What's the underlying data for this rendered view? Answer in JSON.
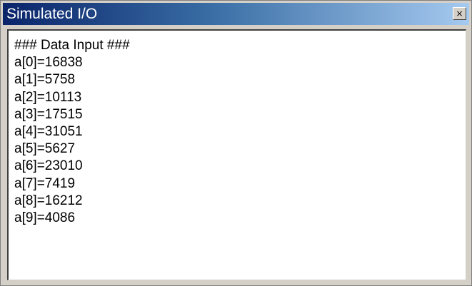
{
  "window": {
    "title": "Simulated I/O",
    "close_glyph": "×",
    "close_icon": "close-icon"
  },
  "output": {
    "lines": [
      "### Data Input ###",
      "a[0]=16838",
      "a[1]=5758",
      "a[2]=10113",
      "a[3]=17515",
      "a[4]=31051",
      "a[5]=5627",
      "a[6]=23010",
      "a[7]=7419",
      "a[8]=16212",
      "a[9]=4086"
    ]
  },
  "colors": {
    "titlebar_start": "#0a246a",
    "titlebar_end": "#a6caf0",
    "frame": "#d4d0c8",
    "text_area": "#ffffff"
  }
}
